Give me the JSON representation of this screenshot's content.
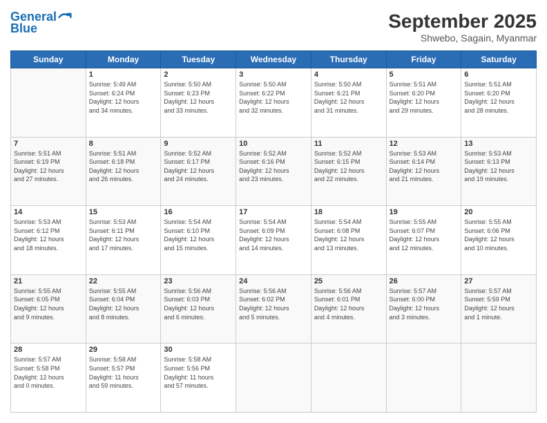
{
  "header": {
    "logo_line1": "General",
    "logo_line2": "Blue",
    "month": "September 2025",
    "location": "Shwebo, Sagain, Myanmar"
  },
  "days_of_week": [
    "Sunday",
    "Monday",
    "Tuesday",
    "Wednesday",
    "Thursday",
    "Friday",
    "Saturday"
  ],
  "weeks": [
    [
      {
        "day": "",
        "info": ""
      },
      {
        "day": "1",
        "info": "Sunrise: 5:49 AM\nSunset: 6:24 PM\nDaylight: 12 hours\nand 34 minutes."
      },
      {
        "day": "2",
        "info": "Sunrise: 5:50 AM\nSunset: 6:23 PM\nDaylight: 12 hours\nand 33 minutes."
      },
      {
        "day": "3",
        "info": "Sunrise: 5:50 AM\nSunset: 6:22 PM\nDaylight: 12 hours\nand 32 minutes."
      },
      {
        "day": "4",
        "info": "Sunrise: 5:50 AM\nSunset: 6:21 PM\nDaylight: 12 hours\nand 31 minutes."
      },
      {
        "day": "5",
        "info": "Sunrise: 5:51 AM\nSunset: 6:20 PM\nDaylight: 12 hours\nand 29 minutes."
      },
      {
        "day": "6",
        "info": "Sunrise: 5:51 AM\nSunset: 6:20 PM\nDaylight: 12 hours\nand 28 minutes."
      }
    ],
    [
      {
        "day": "7",
        "info": "Sunrise: 5:51 AM\nSunset: 6:19 PM\nDaylight: 12 hours\nand 27 minutes."
      },
      {
        "day": "8",
        "info": "Sunrise: 5:51 AM\nSunset: 6:18 PM\nDaylight: 12 hours\nand 26 minutes."
      },
      {
        "day": "9",
        "info": "Sunrise: 5:52 AM\nSunset: 6:17 PM\nDaylight: 12 hours\nand 24 minutes."
      },
      {
        "day": "10",
        "info": "Sunrise: 5:52 AM\nSunset: 6:16 PM\nDaylight: 12 hours\nand 23 minutes."
      },
      {
        "day": "11",
        "info": "Sunrise: 5:52 AM\nSunset: 6:15 PM\nDaylight: 12 hours\nand 22 minutes."
      },
      {
        "day": "12",
        "info": "Sunrise: 5:53 AM\nSunset: 6:14 PM\nDaylight: 12 hours\nand 21 minutes."
      },
      {
        "day": "13",
        "info": "Sunrise: 5:53 AM\nSunset: 6:13 PM\nDaylight: 12 hours\nand 19 minutes."
      }
    ],
    [
      {
        "day": "14",
        "info": "Sunrise: 5:53 AM\nSunset: 6:12 PM\nDaylight: 12 hours\nand 18 minutes."
      },
      {
        "day": "15",
        "info": "Sunrise: 5:53 AM\nSunset: 6:11 PM\nDaylight: 12 hours\nand 17 minutes."
      },
      {
        "day": "16",
        "info": "Sunrise: 5:54 AM\nSunset: 6:10 PM\nDaylight: 12 hours\nand 15 minutes."
      },
      {
        "day": "17",
        "info": "Sunrise: 5:54 AM\nSunset: 6:09 PM\nDaylight: 12 hours\nand 14 minutes."
      },
      {
        "day": "18",
        "info": "Sunrise: 5:54 AM\nSunset: 6:08 PM\nDaylight: 12 hours\nand 13 minutes."
      },
      {
        "day": "19",
        "info": "Sunrise: 5:55 AM\nSunset: 6:07 PM\nDaylight: 12 hours\nand 12 minutes."
      },
      {
        "day": "20",
        "info": "Sunrise: 5:55 AM\nSunset: 6:06 PM\nDaylight: 12 hours\nand 10 minutes."
      }
    ],
    [
      {
        "day": "21",
        "info": "Sunrise: 5:55 AM\nSunset: 6:05 PM\nDaylight: 12 hours\nand 9 minutes."
      },
      {
        "day": "22",
        "info": "Sunrise: 5:55 AM\nSunset: 6:04 PM\nDaylight: 12 hours\nand 8 minutes."
      },
      {
        "day": "23",
        "info": "Sunrise: 5:56 AM\nSunset: 6:03 PM\nDaylight: 12 hours\nand 6 minutes."
      },
      {
        "day": "24",
        "info": "Sunrise: 5:56 AM\nSunset: 6:02 PM\nDaylight: 12 hours\nand 5 minutes."
      },
      {
        "day": "25",
        "info": "Sunrise: 5:56 AM\nSunset: 6:01 PM\nDaylight: 12 hours\nand 4 minutes."
      },
      {
        "day": "26",
        "info": "Sunrise: 5:57 AM\nSunset: 6:00 PM\nDaylight: 12 hours\nand 3 minutes."
      },
      {
        "day": "27",
        "info": "Sunrise: 5:57 AM\nSunset: 5:59 PM\nDaylight: 12 hours\nand 1 minute."
      }
    ],
    [
      {
        "day": "28",
        "info": "Sunrise: 5:57 AM\nSunset: 5:58 PM\nDaylight: 12 hours\nand 0 minutes."
      },
      {
        "day": "29",
        "info": "Sunrise: 5:58 AM\nSunset: 5:57 PM\nDaylight: 11 hours\nand 59 minutes."
      },
      {
        "day": "30",
        "info": "Sunrise: 5:58 AM\nSunset: 5:56 PM\nDaylight: 11 hours\nand 57 minutes."
      },
      {
        "day": "",
        "info": ""
      },
      {
        "day": "",
        "info": ""
      },
      {
        "day": "",
        "info": ""
      },
      {
        "day": "",
        "info": ""
      }
    ]
  ]
}
